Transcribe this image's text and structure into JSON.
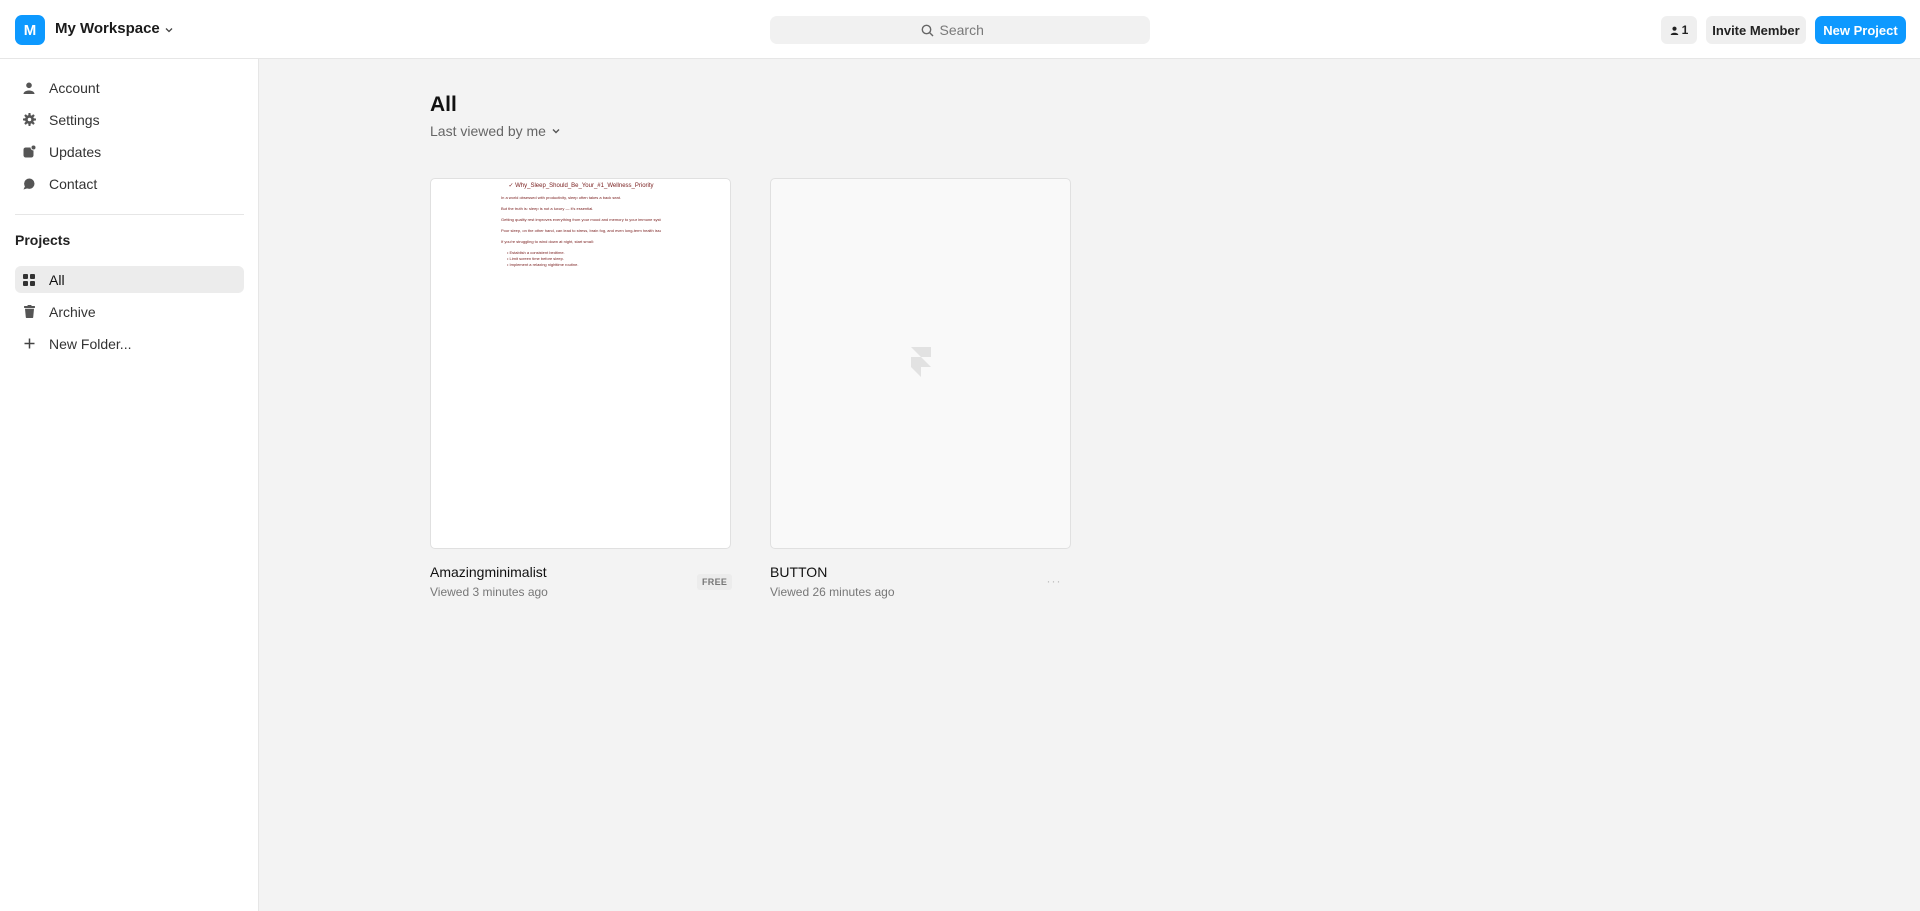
{
  "workspace": {
    "initial": "M",
    "name": "My Workspace"
  },
  "search": {
    "placeholder": "Search"
  },
  "header": {
    "members_count": "1",
    "invite_label": "Invite Member",
    "new_project_label": "New Project"
  },
  "sidebar": {
    "items": [
      {
        "label": "Account",
        "icon": "user-icon"
      },
      {
        "label": "Settings",
        "icon": "gear-icon"
      },
      {
        "label": "Updates",
        "icon": "updates-icon"
      },
      {
        "label": "Contact",
        "icon": "chat-bubble-icon"
      }
    ],
    "projects_title": "Projects",
    "project_items": [
      {
        "label": "All",
        "icon": "grid-icon",
        "active": true
      },
      {
        "label": "Archive",
        "icon": "trash-icon"
      },
      {
        "label": "New Folder...",
        "icon": "plus-icon"
      }
    ]
  },
  "main": {
    "title": "All",
    "sort_label": "Last viewed by me",
    "projects": [
      {
        "name": "Amazingminimalist",
        "meta": "Viewed 3 minutes ago",
        "badge": "FREE",
        "preview": {
          "title": "✓ Why_Sleep_Should_Be_Your_#1_Wellness_Priority",
          "lines": [
            "In a world obsessed with productivity, sleep often takes a back seat.",
            "But the truth is: sleep is not a luxury — it's essential.",
            "Getting quality rest improves everything from your mood and memory to your immune system and metabolism.",
            "Poor sleep, on the other hand, can lead to stress, brain fog, and even long-term health issues.",
            "If you're struggling to wind down at night, start small:"
          ],
          "bullets": [
            "Establish a consistent bedtime.",
            "Limit screen time before sleep.",
            "Implement a relaxing nighttime routine."
          ]
        }
      },
      {
        "name": "BUTTON",
        "meta": "Viewed 26 minutes ago",
        "more": "···"
      }
    ]
  },
  "colors": {
    "accent": "#0d99ff",
    "background": "#f3f3f3",
    "preview_text": "#7a2020"
  }
}
